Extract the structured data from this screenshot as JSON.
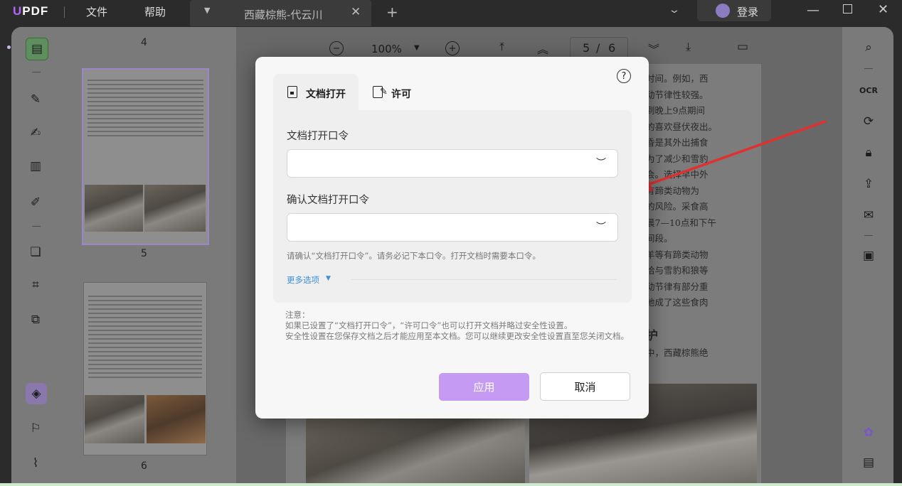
{
  "titlebar": {
    "logo": "UPDF",
    "menu": [
      "文件",
      "帮助"
    ],
    "tab_title": "西藏棕熊-代云川",
    "add_tab": "+",
    "login": "登录"
  },
  "toolbar": {
    "zoom": "100%",
    "current_page": "5",
    "page_separator": "/",
    "total_pages": "6"
  },
  "thumbnails": {
    "page_numbers": [
      "4",
      "5",
      "6"
    ]
  },
  "page_text_lines": [
    "时间。例如，西",
    "动节律性较强。",
    "到晚上9点期间",
    "的喜欢昼伏夜出。",
    "昏是其外出捕食",
    "为了减少和雪豹",
    "会。选择早中外",
    "有蹄类动物为",
    "的风险。采食高",
    "晨7—10点和下午",
    "间段。",
    "羊等有蹄类动物",
    "恰与雪豹和狼等",
    "动节律有部分重",
    "地成了这些食肉",
    "",
    "护",
    "中，西藏棕熊绝"
  ],
  "dialog": {
    "tabs": [
      {
        "label": "文档打开",
        "active": true
      },
      {
        "label": "许可",
        "active": false
      }
    ],
    "open_password_label": "文档打开口令",
    "open_password_value": "",
    "confirm_password_label": "确认文档打开口令",
    "confirm_password_value": "",
    "hint": "请确认“文档打开口令”。请务必记下本口令。打开文档时需要本口令。",
    "more_options": "更多选项",
    "note_title": "注意：",
    "note_line1": "如果已设置了“文档打开口令”，“许可口令”也可以打开文档并略过安全性设置。",
    "note_line2": "安全性设置在您保存文档之后才能应用至本文档。您可以继续更改安全性设置直至您关闭文档。",
    "apply": "应用",
    "cancel": "取消"
  },
  "colors": {
    "accent": "#c59af2",
    "arrow": "#e03030",
    "link": "#3a8fd8"
  }
}
